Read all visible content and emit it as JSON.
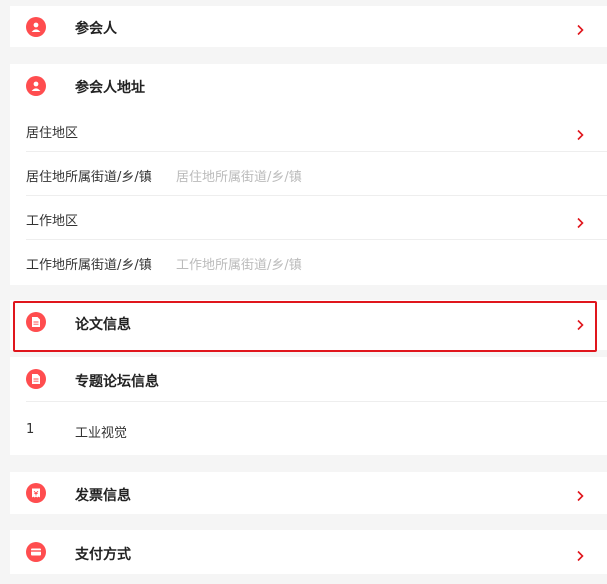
{
  "sections": {
    "attendee": {
      "title": "参会人"
    },
    "attendee_address": {
      "title": "参会人地址",
      "fields": [
        {
          "label": "居住地区",
          "placeholder": ""
        },
        {
          "label": "居住地所属街道/乡/镇",
          "placeholder": "居住地所属街道/乡/镇"
        },
        {
          "label": "工作地区",
          "placeholder": ""
        },
        {
          "label": "工作地所属街道/乡/镇",
          "placeholder": "工作地所属街道/乡/镇"
        }
      ]
    },
    "paper": {
      "title": "论文信息"
    },
    "forum": {
      "title": "专题论坛信息",
      "items": [
        {
          "index": "1",
          "text": "工业视觉"
        }
      ]
    },
    "invoice": {
      "title": "发票信息"
    },
    "payment": {
      "title": "支付方式"
    }
  },
  "colors": {
    "accent": "#ff4d4f",
    "highlight_border": "#e0161d"
  },
  "icons": {
    "attendee": "person-icon",
    "attendee_address": "person-icon",
    "paper": "document-icon",
    "forum": "document-icon",
    "invoice": "ticket-icon",
    "payment": "card-icon",
    "chevron": "chevron-right-icon"
  }
}
